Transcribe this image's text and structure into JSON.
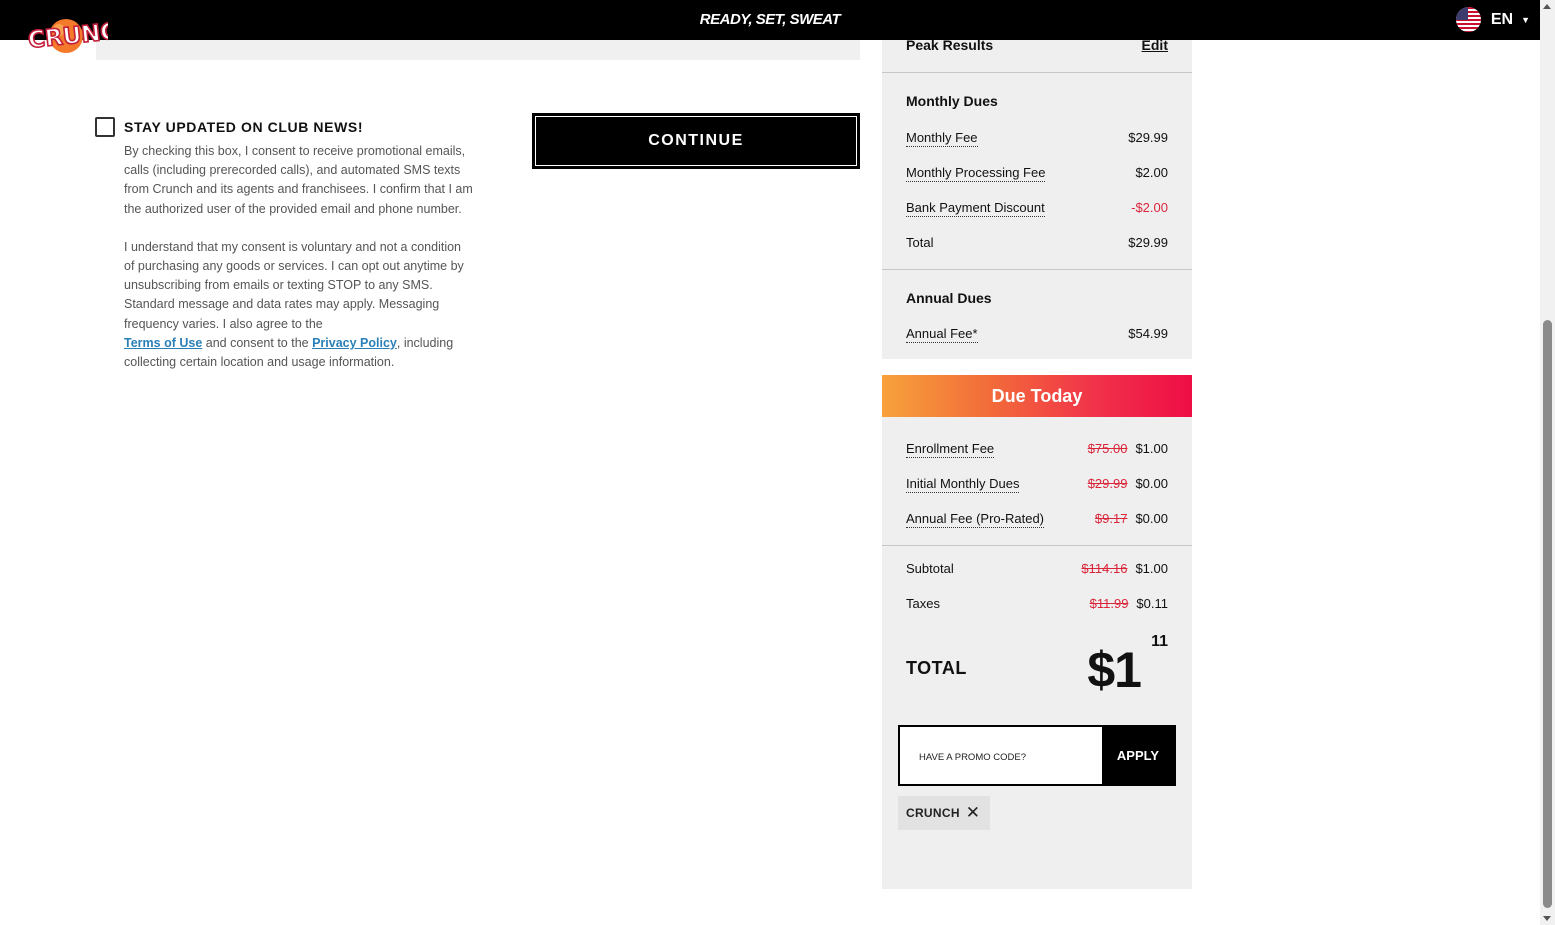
{
  "header": {
    "logo_text": "CRUNCH",
    "tagline": "READY, SET, SWEAT",
    "language": "EN"
  },
  "consent": {
    "title": "STAY UPDATED ON CLUB NEWS!",
    "paragraph1": "By checking this box, I consent to receive promotional emails, calls (including prerecorded calls), and automated SMS texts from Crunch and its agents and franchisees. I confirm that I am the authorized user of the provided email and phone number.",
    "paragraph2_part1": "I understand that my consent is voluntary and not a condition of purchasing any goods or services. I can opt out anytime by unsubscribing from emails or texting STOP to any SMS. Standard message and data rates may apply. Messaging frequency varies. I also agree to the",
    "terms_link": "Terms of Use",
    "paragraph2_part2": "and consent to the",
    "privacy_link": "Privacy Policy",
    "paragraph2_part3": ", including collecting certain location and usage information."
  },
  "continue_label": "CONTINUE",
  "summary": {
    "plan_name": "Peak Results",
    "edit_label": "Edit",
    "monthly": {
      "title": "Monthly Dues",
      "items": [
        {
          "label": "Monthly Fee",
          "value": "$29.99"
        },
        {
          "label": "Monthly Processing Fee",
          "value": "$2.00"
        },
        {
          "label": "Bank Payment Discount",
          "value": "-$2.00"
        },
        {
          "label": "Total",
          "value": "$29.99"
        }
      ]
    },
    "annual": {
      "title": "Annual Dues",
      "items": [
        {
          "label": "Annual Fee*",
          "value": "$54.99"
        }
      ]
    },
    "due_today": {
      "title": "Due Today",
      "items": [
        {
          "label": "Enrollment Fee",
          "original": "$75.00",
          "value": "$1.00"
        },
        {
          "label": "Initial Monthly Dues",
          "original": "$29.99",
          "value": "$0.00"
        },
        {
          "label": "Annual Fee (Pro-Rated)",
          "original": "$9.17",
          "value": "$0.00"
        }
      ],
      "subtotal": {
        "label": "Subtotal",
        "original": "$114.16",
        "value": "$1.00"
      },
      "taxes": {
        "label": "Taxes",
        "original": "$11.99",
        "value": "$0.11"
      },
      "total_label": "TOTAL",
      "total_dollars": "$1",
      "total_cents": "11"
    },
    "promo": {
      "placeholder": "HAVE A PROMO CODE?",
      "apply_label": "APPLY",
      "applied_code": "CRUNCH"
    }
  },
  "colors": {
    "accent_red": "#d9263b",
    "link_blue": "#2a7fb8",
    "gradient_start": "#f7a23b",
    "gradient_end": "#ee0e45"
  }
}
